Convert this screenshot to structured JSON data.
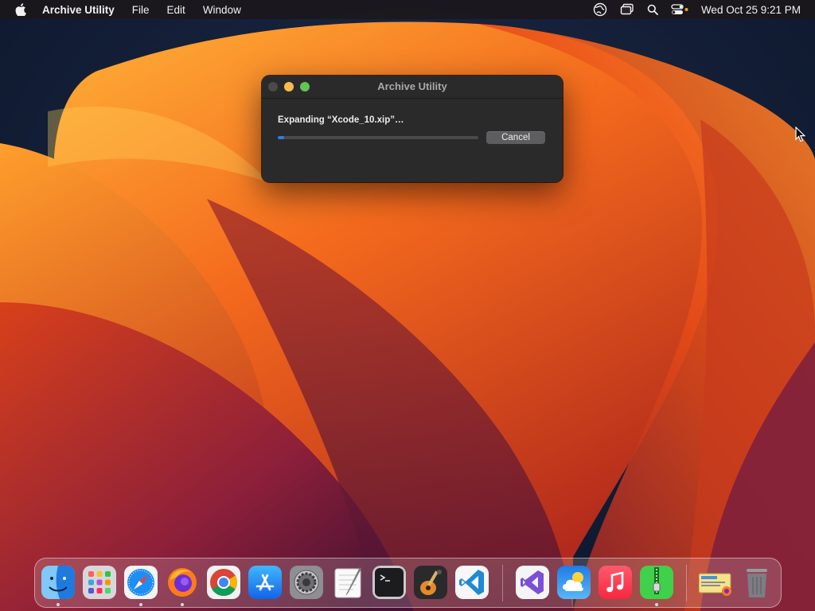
{
  "menubar": {
    "apple_icon": "apple-logo-icon",
    "app_name": "Archive Utility",
    "menus": [
      "File",
      "Edit",
      "Window"
    ],
    "status_icons": [
      "network-globe-icon",
      "screen-mirroring-icon",
      "spotlight-search-icon",
      "control-center-icon"
    ],
    "clock": "Wed Oct 25  9:21 PM"
  },
  "dialog": {
    "title": "Archive Utility",
    "status_text": "Expanding “Xcode_10.xip”…",
    "progress": 0.03,
    "cancel_label": "Cancel"
  },
  "dock": {
    "apps": [
      "Finder",
      "Launchpad",
      "Safari",
      "Firefox",
      "Google Chrome",
      "App Store",
      "System Preferences",
      "TextEdit",
      "Terminal",
      "GarageBand",
      "Visual Studio Code",
      "Visual Studio",
      "Weather",
      "Music",
      "Archive Utility"
    ],
    "running": [
      "Finder",
      "Safari",
      "Firefox",
      "Archive Utility"
    ],
    "stack": "Downloads",
    "trash": "Trash"
  },
  "colors": {
    "accent": "#2f7ce6",
    "wallpaper_primary": "#f2671b",
    "wallpaper_secondary": "#7a1f3d"
  }
}
